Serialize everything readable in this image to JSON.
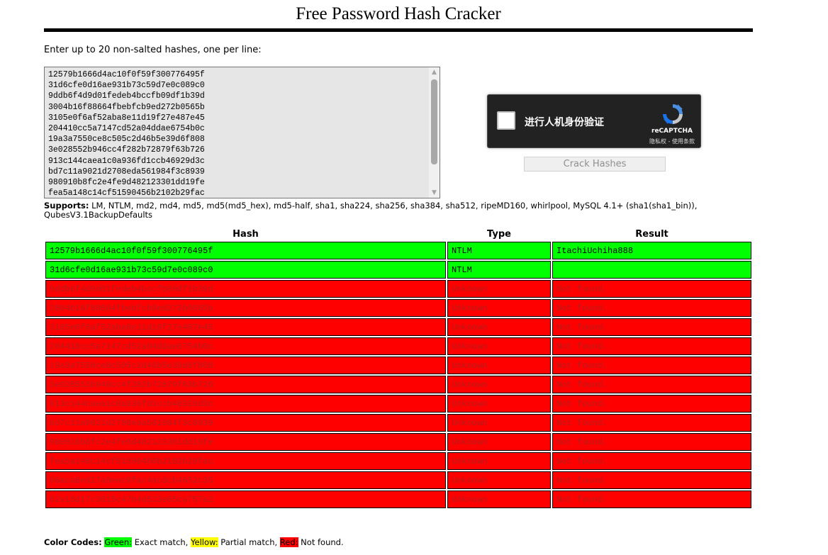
{
  "title": "Free Password Hash Cracker",
  "instruction": "Enter up to 20 non-salted hashes, one per line:",
  "hash_input": "12579b1666d4ac10f0f59f300776495f\n31d6cfe0d16ae931b73c59d7e0c089c0\n9ddb6f4d9d01fedeb4bccfb09df1b39d\n3004b16f88664fbebfcb9ed272b0565b\n3105e0f6af52aba8e11d19f27e487e45\n204410cc5a7147cd52a04ddae6754b0c\n19a3a7550ce8c505c2d46b5e39d6f808\n3e028552b946cc4f282b72879f63b726\n913c144caea1c0a936fd1ccb46929d3c\nbd7c11a9021d2708eda561984f3c8939\n980910b8fc2e4fe9d482123301dd19fe\nfea5a148c14cf51590456b2102b29fac",
  "recaptcha": {
    "label": "进行人机身份验证",
    "brand": "reCAPTCHA",
    "links": "隐私权 - 使用条款"
  },
  "crack_button": "Crack Hashes",
  "supports": {
    "label": "Supports:",
    "text": " LM, NTLM, md2, md4, md5, md5(md5_hex), md5-half, sha1, sha224, sha256, sha384, sha512, ripeMD160, whirlpool, MySQL 4.1+ (sha1(sha1_bin)), QubesV3.1BackupDefaults"
  },
  "table": {
    "headers": [
      "Hash",
      "Type",
      "Result"
    ],
    "rows": [
      {
        "hash": "12579b1666d4ac10f0f59f300776495f",
        "type": "NTLM",
        "result": "ItachiUchiha888",
        "status": "green"
      },
      {
        "hash": "31d6cfe0d16ae931b73c59d7e0c089c0",
        "type": "NTLM",
        "result": "",
        "status": "green"
      },
      {
        "hash": "9ddb6f4d9d01fedeb4bccfb09df1b39d",
        "type": "Unknown",
        "result": "Not found.",
        "status": "red"
      },
      {
        "hash": "3004b16f88664fbebfcb9ed272b0565b",
        "type": "Unknown",
        "result": "Not found.",
        "status": "red"
      },
      {
        "hash": "3105e0f6af52aba8e11d19f27e487e45",
        "type": "Unknown",
        "result": "Not found.",
        "status": "red"
      },
      {
        "hash": "204410cc5a7147cd52a04ddae6754b0c",
        "type": "Unknown",
        "result": "Not found.",
        "status": "red"
      },
      {
        "hash": "19a3a7550ce8c505c2d46b5e39d6f808",
        "type": "Unknown",
        "result": "Not found.",
        "status": "red"
      },
      {
        "hash": "3e028552b946cc4f282b72879f63b726",
        "type": "Unknown",
        "result": "Not found.",
        "status": "red"
      },
      {
        "hash": "913c144caea1c0a936fd1ccb46929d3c",
        "type": "Unknown",
        "result": "Not found.",
        "status": "red"
      },
      {
        "hash": "bd7c11a9021d2708eda561984f3c8939",
        "type": "Unknown",
        "result": "Not found.",
        "status": "red"
      },
      {
        "hash": "980910b8fc2e4fe9d482123301dd19fe",
        "type": "Unknown",
        "result": "Not found.",
        "status": "red"
      },
      {
        "hash": "fea5a148c14cf51590456b2102b29fac",
        "type": "Unknown",
        "result": "Not found.",
        "status": "red"
      },
      {
        "hash": "08aca8ed17a9eec9fac4acdcb4652c35",
        "type": "Unknown",
        "result": "Not found.",
        "status": "red"
      },
      {
        "hash": "62e18d17c3015c47b4d513e65ca757a2",
        "type": "Unknown",
        "result": "Not found.",
        "status": "red"
      }
    ]
  },
  "legend": {
    "label": "Color Codes:",
    "green": "Green:",
    "green_text": " Exact match, ",
    "yellow": "Yellow:",
    "yellow_text": " Partial match, ",
    "red": "Red:",
    "red_text": " Not found."
  },
  "colors": {
    "exact": "#00ff00",
    "partial": "#ffff00",
    "not_found": "#ff0000"
  },
  "icons": {
    "recaptcha_logo": "recaptcha-logo-icon",
    "scroll_up": "scroll-up-arrow-icon",
    "scroll_down": "scroll-down-arrow-icon"
  }
}
